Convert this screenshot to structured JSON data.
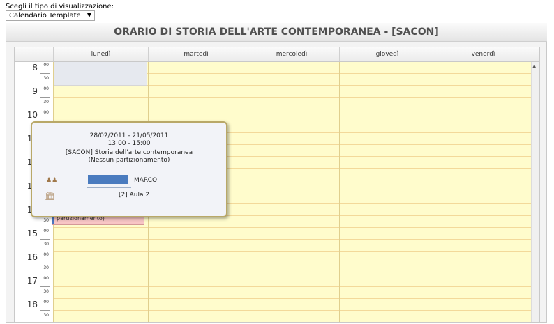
{
  "view_label": "Scegli il tipo di visualizzazione:",
  "view_select": "Calendario Template",
  "calendar_title": "ORARIO DI STORIA DELL'ARTE CONTEMPORANEA - [SACON]",
  "days": [
    "lunedì",
    "martedì",
    "mercoledì",
    "giovedì",
    "venerdì"
  ],
  "hours": [
    "8",
    "9",
    "10",
    "11",
    "12",
    "13",
    "14",
    "15",
    "16",
    "17",
    "18"
  ],
  "minute_00": "00",
  "minute_30": "30",
  "event": {
    "text": "partizionamento)"
  },
  "popup": {
    "date_range": "28/02/2011 - 21/05/2011",
    "time_range": "13:00 - 15:00",
    "course": "[SACON] Storia dell'arte contemporanea",
    "partition": "(Nessun partizionamento)",
    "teacher": "MARCO",
    "room": "[2] Aula 2"
  },
  "icons": {
    "teacher": "people-icon",
    "room": "building-icon",
    "scroll": "scroll-up-arrow-icon",
    "select": "chevron-down-icon"
  },
  "colors": {
    "slot_bg": "#fffccc",
    "event_bg": "#f8c5c5",
    "teacher_bar": "#4a7bbf",
    "popup_border": "#b9a868"
  }
}
